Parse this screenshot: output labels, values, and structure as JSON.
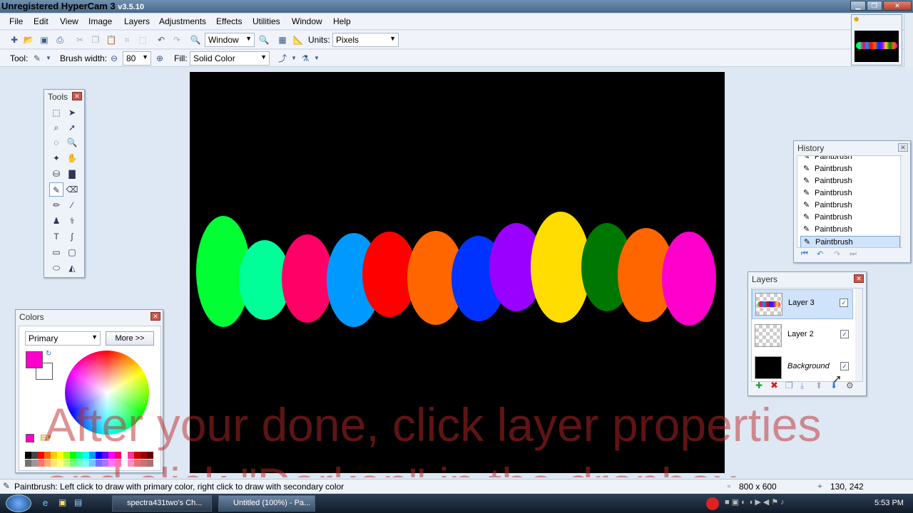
{
  "titlebar": {
    "title": "Unregistered HyperCam 3",
    "version": "v3.5.10"
  },
  "menu": [
    "File",
    "Edit",
    "View",
    "Image",
    "Layers",
    "Adjustments",
    "Effects",
    "Utilities",
    "Window",
    "Help"
  ],
  "toolbar": {
    "zoom_value": "Window",
    "units_label": "Units:",
    "units_value": "Pixels",
    "tool_label": "Tool:",
    "brush_width_label": "Brush width:",
    "brush_width_value": "80",
    "fill_label": "Fill:",
    "fill_value": "Solid Color"
  },
  "tools_panel": {
    "title": "Tools"
  },
  "colors_panel": {
    "title": "Colors",
    "mode": "Primary",
    "more_label": "More >>",
    "primary_color": "#ff00cc",
    "secondary_color": "#ffffff"
  },
  "history_panel": {
    "title": "History",
    "items": [
      "Paintbrush",
      "Paintbrush",
      "Paintbrush",
      "Paintbrush",
      "Paintbrush",
      "Paintbrush",
      "Paintbrush",
      "Paintbrush"
    ]
  },
  "layers_panel": {
    "title": "Layers",
    "layers": [
      {
        "name": "Layer 3",
        "selected": true
      },
      {
        "name": "Layer 2",
        "selected": false
      },
      {
        "name": "Background",
        "selected": false
      }
    ]
  },
  "canvas": {
    "blobs": [
      "#00ff33",
      "#00ff99",
      "#ff0066",
      "#0099ff",
      "#ff0000",
      "#ff6600",
      "#0033ff",
      "#9900ff",
      "#ffdd00",
      "#007700",
      "#ff6600",
      "#ff00cc"
    ]
  },
  "overlay": {
    "line1": "After your done, click layer properties",
    "line2": "and click \"Darken\" in the dropbox"
  },
  "status": {
    "hint": "Paintbrush: Left click to draw with primary color, right click to draw with secondary color",
    "size": "800 x 600",
    "coords": "130, 242"
  },
  "taskbar": {
    "tasks": [
      "spectra431two's Ch...",
      "Untitled (100%) - Pa..."
    ],
    "clock": "5:53 PM"
  }
}
